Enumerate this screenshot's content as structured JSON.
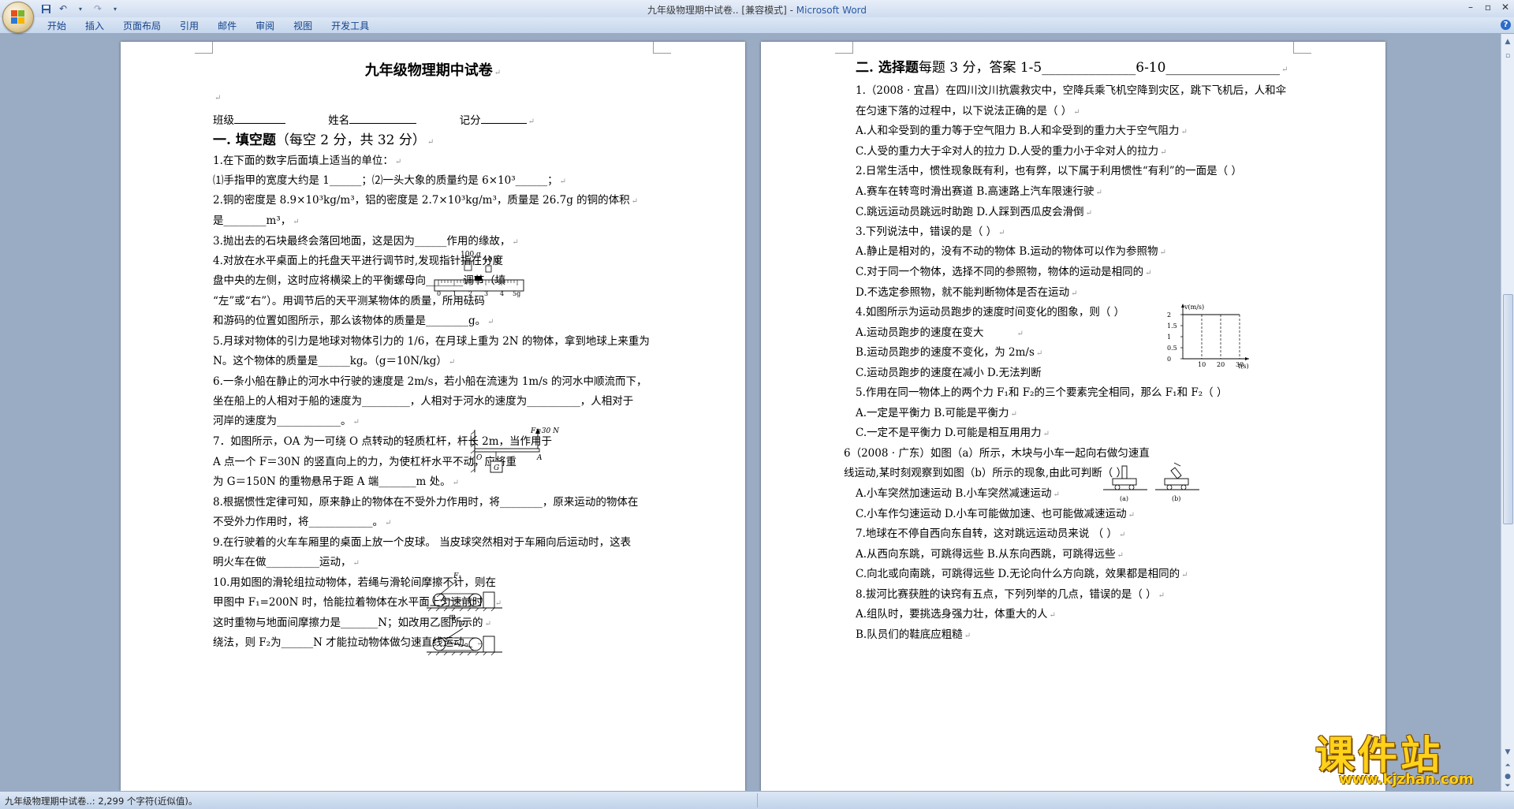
{
  "window": {
    "title_doc": "九年级物理期中试卷.. [兼容模式] - ",
    "title_app": "Microsoft Word"
  },
  "ribbon": {
    "tabs": [
      "开始",
      "插入",
      "页面布局",
      "引用",
      "邮件",
      "审阅",
      "视图",
      "开发工具"
    ]
  },
  "status": {
    "text": "九年级物理期中试卷..: 2,299 个字符(近似值)。"
  },
  "watermark": {
    "brand": "课件站",
    "url": "www.kjzhan.com"
  },
  "page1": {
    "title": "九年级物理期中试卷",
    "info": {
      "class_label": "班级",
      "name_label": "姓名",
      "score_label": "记分"
    },
    "section1": {
      "title": "一. 填空题",
      "note": "（每空 2 分，共 32 分）"
    },
    "lines": [
      "1.在下面的数字后面填上适当的单位：",
      "⑴手指甲的宽度大约是 1______；⑵一头大象的质量约是 6×10³______；",
      "2.铜的密度是 8.9×10³kg/m³，铝的密度是 2.7×10³kg/m³，质量是 26.7g 的铜的体积",
      "是________m³，",
      "3.抛出去的石块最终会落回地面，这是因为______作用的缘故，",
      "4.对放在水平桌面上的托盘天平进行调节时,发现指针指在分度",
      "盘中央的左侧，这时应将横梁上的平衡螺母向_______调节（填",
      "“左”或“右”）。用调节后的天平测某物体的质量，所用砝码",
      "和游码的位置如图所示，那么该物体的质量是________g。",
      "5.月球对物体的引力是地球对物体引力的 1/6，在月球上重为 2N 的物体，拿到地球上来重为",
      "N。这个物体的质量是______kg。（g＝10N/kg）",
      "6.一条小船在静止的河水中行驶的速度是 2m/s，若小船在流速为 1m/s 的河水中顺流而下，",
      "坐在船上的人相对于船的速度为_________，人相对于河水的速度为__________，人相对于",
      "河岸的速度为____________。",
      "7．如图所示，OA 为一可绕 O 点转动的轻质杠杆，杆长 2m，当作用于",
      "A 点一个 F＝30N 的竖直向上的力，为使杠杆水平不动，应将重",
      "为 G＝150N 的重物悬吊于距 A 端_______m 处。",
      "8.根据惯性定律可知，原来静止的物体在不受外力作用时，将________，原来运动的物体在",
      "不受外力作用时，将____________。",
      "9.在行驶着的火车车厢里的桌面上放一个皮球。 当皮球突然相对于车厢向后运动时，这表",
      "明火车在做__________运动，",
      "10.用如图的滑轮组拉动物体，若绳与滑轮间摩擦不计，则在",
      "甲图中 F₁=200N 时，恰能拉着物体在水平面上匀速前时，",
      "这时重物与地面间摩擦力是_______N；如改用乙图所示的",
      "绕法，则 F₂为______N 才能拉动物体做匀速直线运动。"
    ],
    "figs": {
      "balance_w1": "100 g",
      "balance_w2": "10 g",
      "scale_ticks": [
        "0",
        "1",
        "2",
        "3",
        "4",
        "5g"
      ],
      "lever_F": "F=30 N",
      "lever_O": "O",
      "lever_A": "A",
      "lever_G": "G",
      "pulley_F1": "F₁",
      "pulley_jia": "甲",
      "pulley_F2": "F₂"
    }
  },
  "page2": {
    "header": {
      "title": "二. 选择题",
      "rest": "每题 3 分，答案 1-5______________6-10_________________"
    },
    "lines": [
      "1.（2008 · 宜昌）在四川汶川抗震救灾中，空降兵乘飞机空降到灾区，跳下飞机后，人和伞",
      "在匀速下落的过程中，以下说法正确的是（      ）",
      "A.人和伞受到的重力等于空气阻力                    B.人和伞受到的重力大于空气阻力",
      "C.人受的重力大于伞对人的拉力                       D.人受的重力小于伞对人的拉力",
      "2.日常生活中，惯性现象既有利，也有弊，以下属于利用惯性“有利”的一面是（      ）",
      "A.赛车在转弯时滑出赛道                                B.高速路上汽车限速行驶",
      "C.跳远运动员跳远时助跑                                D.人踩到西瓜皮会滑倒",
      "3.下列说法中，错误的是（      ）",
      "A.静止是相对的，没有不动的物体                    B.运动的物体可以作为参照物",
      "C.对于同一个物体，选择不同的参照物，物体的运动是相同的",
      "D.不选定参照物，就不能判断物体是否在运动",
      "4.如图所示为运动员跑步的速度时间变化的图象，则（      ）",
      "A.运动员跑步的速度在变大",
      "B.运动员跑步的速度不变化，为 2m/s",
      "C.运动员跑步的速度在减小                D.无法判断",
      "5.作用在同一物体上的两个力 F₁和 F₂的三个要素完全相同，那么 F₁和 F₂（      ）",
      "A.一定是平衡力                               B.可能是平衡力",
      "C.一定不是平衡力                            D.可能是相互用用力",
      "6（2008 · 广东）如图（a）所示，木块与小车一起向右做匀速直",
      "线运动,某时刻观察到如图（b）所示的现象,由此可判断（      ）",
      "A.小车突然加速运动            B.小车突然减速运动",
      "C.小车作匀速运动               D.小车可能做加速、也可能做减速运动",
      "7.地球在不停自西向东自转，这对跳远运动员来说        （      ）",
      "A.从西向东跳，可跳得远些          B.从东向西跳，可跳得远些",
      "C.向北或向南跳，可跳得远些        D.无论向什么方向跳，效果都是相同的",
      "8.拔河比赛获胜的诀窍有五点，下列列举的几点，错误的是（      ）",
      "A.组队时，要挑选身强力壮，体重大的人",
      "B.队员们的鞋底应粗糙"
    ],
    "figs": {
      "graph_ylabel": "v(m/s)",
      "graph_yticks": [
        "2",
        "1.5",
        "1",
        "0.5",
        "0"
      ],
      "graph_xticks": [
        "10",
        "20",
        "30"
      ],
      "graph_xlabel": "t(s)",
      "cart_a": "(a)",
      "cart_b": "(b)"
    }
  },
  "chart_data": {
    "type": "line",
    "xlabel": "t(s)",
    "ylabel": "v(m/s)",
    "x": [
      0,
      10,
      20,
      30
    ],
    "series": [
      {
        "values": [
          2,
          2,
          2,
          2
        ]
      }
    ],
    "xticks": [
      "10",
      "20",
      "30"
    ],
    "yticks": [
      "2",
      "1.5",
      "1",
      "0.5",
      "0"
    ],
    "ylim": [
      0,
      2
    ]
  }
}
